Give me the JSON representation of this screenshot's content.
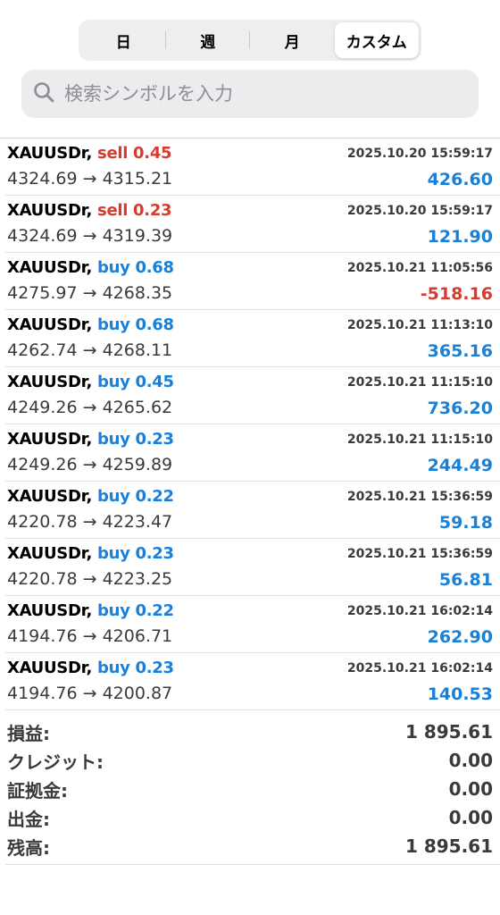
{
  "tabs": [
    {
      "label": "日"
    },
    {
      "label": "週"
    },
    {
      "label": "月"
    },
    {
      "label": "カスタム"
    }
  ],
  "active_tab": "カスタム",
  "search": {
    "placeholder": "検索シンボルを入力",
    "value": ""
  },
  "colors": {
    "sell": "#d63b2f",
    "buy": "#1a7fd6",
    "profit_positive": "#1a7fd6",
    "profit_negative": "#d63b2f"
  },
  "trades": [
    {
      "symbol": "XAUUSDr,",
      "side": "sell",
      "volume": "0.45",
      "side_text": "sell 0.45",
      "datetime": "2025.10.20 15:59:17",
      "prices": "4324.69 → 4315.21",
      "profit": "426.60"
    },
    {
      "symbol": "XAUUSDr,",
      "side": "sell",
      "volume": "0.23",
      "side_text": "sell 0.23",
      "datetime": "2025.10.20 15:59:17",
      "prices": "4324.69 → 4319.39",
      "profit": "121.90"
    },
    {
      "symbol": "XAUUSDr,",
      "side": "buy",
      "volume": "0.68",
      "side_text": "buy 0.68",
      "datetime": "2025.10.21 11:05:56",
      "prices": "4275.97 → 4268.35",
      "profit": "-518.16"
    },
    {
      "symbol": "XAUUSDr,",
      "side": "buy",
      "volume": "0.68",
      "side_text": "buy 0.68",
      "datetime": "2025.10.21 11:13:10",
      "prices": "4262.74 → 4268.11",
      "profit": "365.16"
    },
    {
      "symbol": "XAUUSDr,",
      "side": "buy",
      "volume": "0.45",
      "side_text": "buy 0.45",
      "datetime": "2025.10.21 11:15:10",
      "prices": "4249.26 → 4265.62",
      "profit": "736.20"
    },
    {
      "symbol": "XAUUSDr,",
      "side": "buy",
      "volume": "0.23",
      "side_text": "buy 0.23",
      "datetime": "2025.10.21 11:15:10",
      "prices": "4249.26 → 4259.89",
      "profit": "244.49"
    },
    {
      "symbol": "XAUUSDr,",
      "side": "buy",
      "volume": "0.22",
      "side_text": "buy 0.22",
      "datetime": "2025.10.21 15:36:59",
      "prices": "4220.78 → 4223.47",
      "profit": "59.18"
    },
    {
      "symbol": "XAUUSDr,",
      "side": "buy",
      "volume": "0.23",
      "side_text": "buy 0.23",
      "datetime": "2025.10.21 15:36:59",
      "prices": "4220.78 → 4223.25",
      "profit": "56.81"
    },
    {
      "symbol": "XAUUSDr,",
      "side": "buy",
      "volume": "0.22",
      "side_text": "buy 0.22",
      "datetime": "2025.10.21 16:02:14",
      "prices": "4194.76 → 4206.71",
      "profit": "262.90"
    },
    {
      "symbol": "XAUUSDr,",
      "side": "buy",
      "volume": "0.23",
      "side_text": "buy 0.23",
      "datetime": "2025.10.21 16:02:14",
      "prices": "4194.76 → 4200.87",
      "profit": "140.53"
    }
  ],
  "summary": [
    {
      "label": "損益:",
      "value": "1 895.61"
    },
    {
      "label": "クレジット:",
      "value": "0.00"
    },
    {
      "label": "証拠金:",
      "value": "0.00"
    },
    {
      "label": "出金:",
      "value": "0.00"
    },
    {
      "label": "残高:",
      "value": "1 895.61"
    }
  ]
}
